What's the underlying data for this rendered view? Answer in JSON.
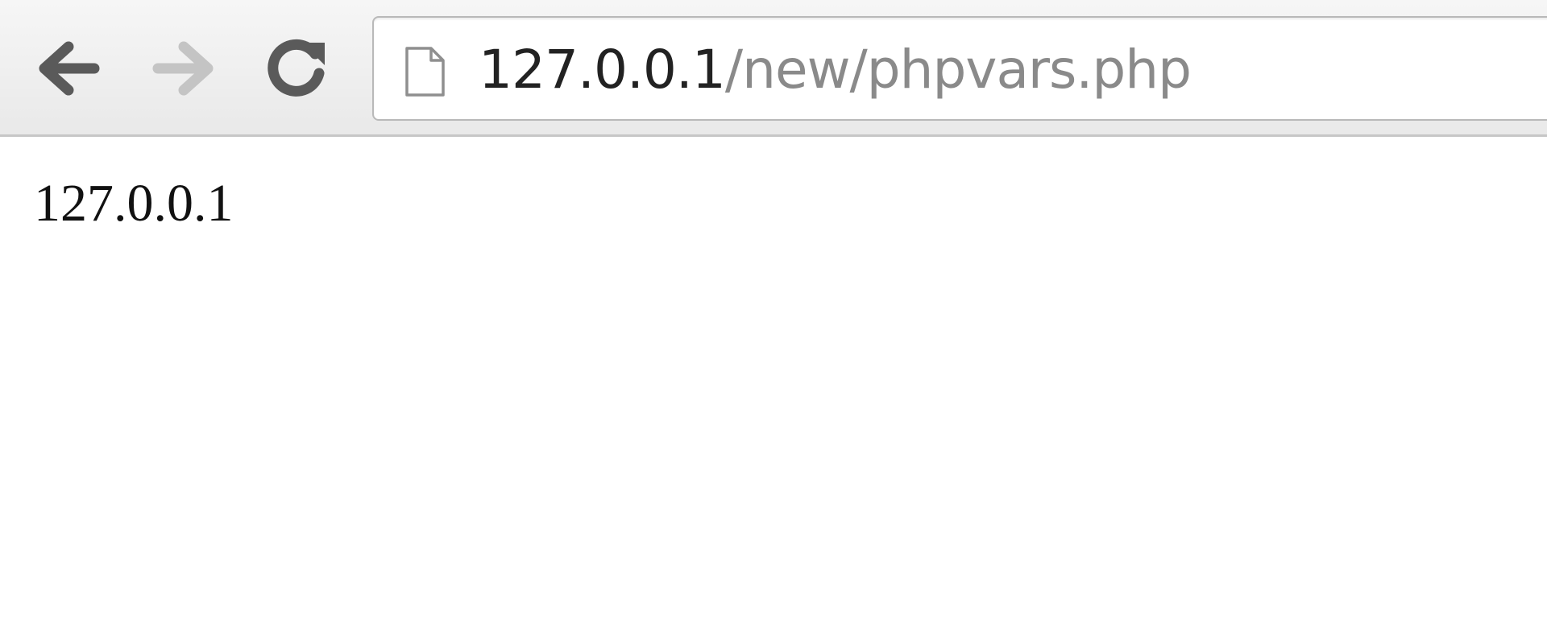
{
  "toolbar": {
    "icons": {
      "back": "back-arrow-icon",
      "forward": "forward-arrow-icon",
      "reload": "reload-icon",
      "page": "page-icon"
    },
    "address_bar": {
      "host": "127.0.0.1",
      "path": "/new/phpvars.php"
    },
    "colors": {
      "active_icon": "#5a5a5a",
      "disabled_icon": "#c4c4c4",
      "url_host": "#222222",
      "url_path": "#8a8a8a"
    }
  },
  "page": {
    "body_text": "127.0.0.1"
  }
}
